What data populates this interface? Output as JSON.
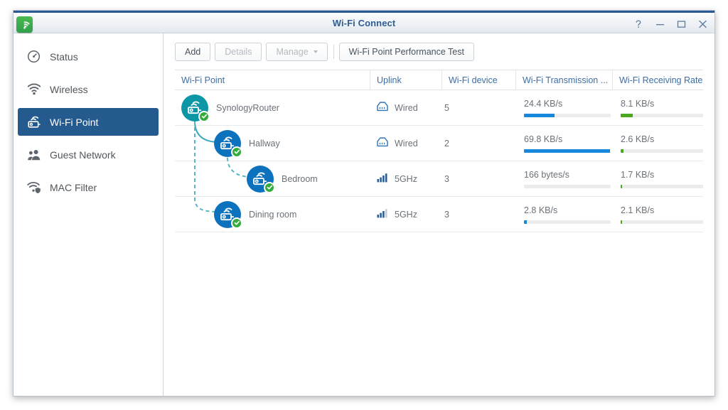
{
  "window": {
    "title": "Wi-Fi Connect",
    "app_icon": "wifi-icon",
    "controls": {
      "help": "?",
      "minimize": "–",
      "maximize": "□",
      "close": "✕"
    }
  },
  "sidebar": {
    "items": [
      {
        "label": "Status",
        "icon": "speedometer-icon",
        "selected": false
      },
      {
        "label": "Wireless",
        "icon": "wifi-icon",
        "selected": false
      },
      {
        "label": "Wi-Fi Point",
        "icon": "router-icon",
        "selected": true
      },
      {
        "label": "Guest Network",
        "icon": "users-icon",
        "selected": false
      },
      {
        "label": "MAC Filter",
        "icon": "wifi-shield-icon",
        "selected": false
      }
    ]
  },
  "toolbar": {
    "add_label": "Add",
    "details_label": "Details",
    "manage_label": "Manage",
    "performance_test_label": "Wi-Fi Point Performance Test"
  },
  "table": {
    "columns": [
      "Wi-Fi Point",
      "Uplink",
      "Wi-Fi device",
      "Wi-Fi Transmission ...",
      "Wi-Fi Receiving Rate"
    ],
    "rows": [
      {
        "name": "SynologyRouter",
        "icon": "router-node-icon",
        "icon_color": "#0d97a6",
        "status": "connected",
        "depth": 0,
        "uplink": "Wired",
        "uplink_icon": "ethernet-icon",
        "signal_bars": 0,
        "devices": "5",
        "tx_rate": "24.4 KB/s",
        "tx_percent": 35,
        "rx_rate": "8.1 KB/s",
        "rx_percent": 14
      },
      {
        "name": "Hallway",
        "icon": "router-node-icon",
        "icon_color": "#0c72bd",
        "status": "connected",
        "depth": 1,
        "uplink": "Wired",
        "uplink_icon": "ethernet-icon",
        "signal_bars": 0,
        "devices": "2",
        "tx_rate": "69.8 KB/s",
        "tx_percent": 99,
        "rx_rate": "2.6 KB/s",
        "rx_percent": 3
      },
      {
        "name": "Bedroom",
        "icon": "router-node-icon",
        "icon_color": "#0c72bd",
        "status": "connected",
        "depth": 2,
        "uplink": "5GHz",
        "uplink_icon": "signal-bars-icon",
        "signal_bars": 4,
        "devices": "3",
        "tx_rate": "166 bytes/s",
        "tx_percent": 0,
        "rx_rate": "1.7 KB/s",
        "rx_percent": 2
      },
      {
        "name": "Dining room",
        "icon": "router-node-icon",
        "icon_color": "#0c72bd",
        "status": "connected",
        "depth": 1,
        "uplink": "5GHz",
        "uplink_icon": "signal-bars-icon",
        "signal_bars": 3,
        "devices": "3",
        "tx_rate": "2.8 KB/s",
        "tx_percent": 3,
        "rx_rate": "2.1 KB/s",
        "rx_percent": 2
      }
    ]
  },
  "colors": {
    "accent_blue": "#245a8d",
    "tx_bar": "#1787db",
    "rx_bar": "#4aa821",
    "router_teal": "#0d97a6",
    "ap_blue": "#0c72bd",
    "check_green": "#35ad3c",
    "tree_line": "#58b5c4"
  }
}
